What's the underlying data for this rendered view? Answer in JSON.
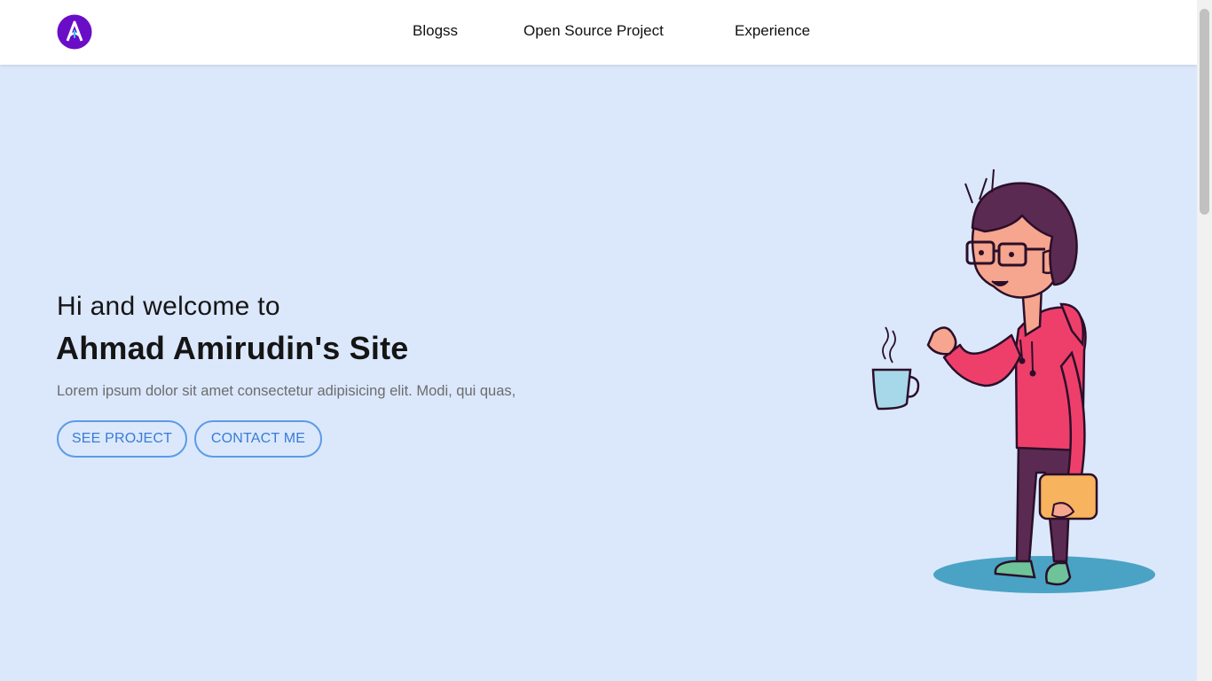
{
  "navbar": {
    "logo_letter": "A",
    "links": [
      {
        "label": "Blogss"
      },
      {
        "label": "Open Source Project"
      },
      {
        "label": "Experience"
      }
    ]
  },
  "hero": {
    "greeting": "Hi and welcome to",
    "title": "Ahmad Amirudin's Site",
    "description": "Lorem ipsum dolor sit amet consectetur adipisicing elit. Modi, qui quas,",
    "buttons": {
      "project_label": "SEE PROJECT",
      "contact_label": "CONTACT ME"
    }
  },
  "colors": {
    "hero_bg": "#dbe8fc",
    "accent": "#5b9be6",
    "logo": "#6a0dc7"
  }
}
